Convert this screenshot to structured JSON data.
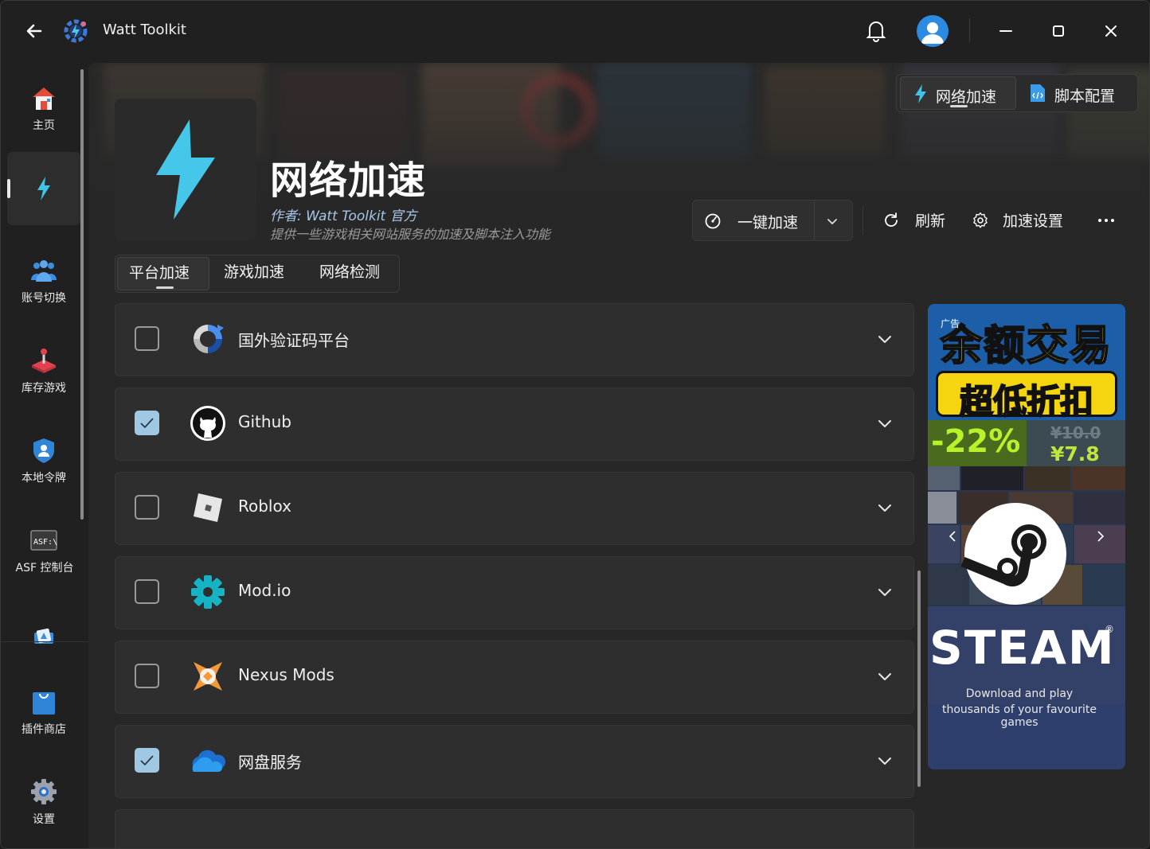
{
  "app": {
    "title": "Watt Toolkit"
  },
  "sidebar": {
    "items": [
      {
        "label": "主页",
        "icon": "home-icon"
      },
      {
        "label": "",
        "icon": "lightning-icon",
        "active": true
      },
      {
        "label": "账号切换",
        "icon": "users-icon"
      },
      {
        "label": "库存游戏",
        "icon": "joystick-icon"
      },
      {
        "label": "本地令牌",
        "icon": "shield-user-icon"
      },
      {
        "label": "ASF 控制台",
        "icon": "asf-console-icon"
      },
      {
        "label": "",
        "icon": "cards-icon"
      },
      {
        "label": "插件商店",
        "icon": "shopping-bag-icon"
      },
      {
        "label": "设置",
        "icon": "gear-icon"
      }
    ],
    "asf_icon_text": "ASF:\\"
  },
  "header": {
    "switcher": {
      "network": "网络加速",
      "script": "脚本配置",
      "active": "network"
    },
    "title": "网络加速",
    "author": "作者:  Watt Toolkit  官方",
    "description": "提供一些游戏相关网站服务的加速及脚本注入功能",
    "accelerate_button": "一键加速",
    "refresh_button": "刷新",
    "settings_button": "加速设置"
  },
  "tabs": [
    {
      "label": "平台加速",
      "active": true
    },
    {
      "label": "游戏加速",
      "active": false
    },
    {
      "label": "网络检测",
      "active": false
    }
  ],
  "services": [
    {
      "name": "国外验证码平台",
      "checked": false,
      "icon": "recaptcha-icon"
    },
    {
      "name": "Github",
      "checked": true,
      "icon": "github-icon"
    },
    {
      "name": "Roblox",
      "checked": false,
      "icon": "roblox-icon"
    },
    {
      "name": "Mod.io",
      "checked": false,
      "icon": "modio-icon"
    },
    {
      "name": "Nexus Mods",
      "checked": false,
      "icon": "nexus-mods-icon"
    },
    {
      "name": "网盘服务",
      "checked": true,
      "icon": "cloud-icon"
    }
  ],
  "ad": {
    "tag": "广告",
    "headline": "余额交易",
    "subheadline": "超低折扣",
    "discount": "-22%",
    "old_price": "¥10.0",
    "new_price": "¥7.8",
    "brand": "STEAM",
    "reg": "®",
    "line1": "Download and play",
    "line2": "thousands of your favourite games"
  },
  "colors": {
    "accent": "#3fc3e6",
    "checkbox_checked": "#9fc8e2",
    "background": "#272727"
  }
}
